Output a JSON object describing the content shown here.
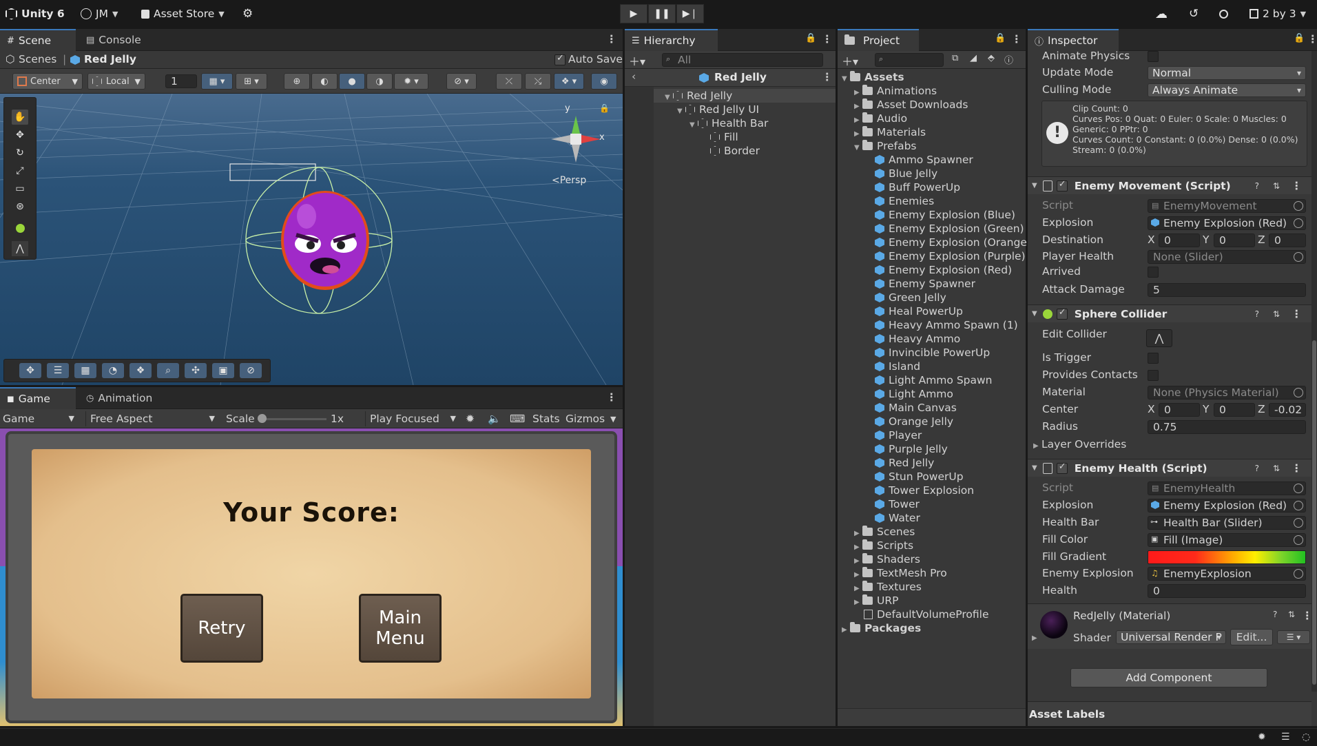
{
  "topbar": {
    "app_title": "Unity 6",
    "account": "JM",
    "asset_store": "Asset Store",
    "layout": "2 by 3"
  },
  "scene_panel": {
    "tabs": [
      "Scene",
      "Console"
    ],
    "breadcrumb": {
      "root": "Scenes",
      "current": "Red Jelly"
    },
    "auto_save": "Auto Save",
    "pivot": "Center",
    "space": "Local",
    "snap_value": "1",
    "persp_label": "<Persp",
    "axis_x": "x",
    "axis_y": "y"
  },
  "game_panel": {
    "tabs": [
      "Game",
      "Animation"
    ],
    "display": "Game",
    "aspect": "Free Aspect",
    "scale_label": "Scale",
    "scale_value": "1x",
    "play_mode": "Play Focused",
    "stats": "Stats",
    "gizmos": "Gizmos",
    "score_title": "Your Score:",
    "retry": "Retry",
    "main_menu_1": "Main",
    "main_menu_2": "Menu"
  },
  "hierarchy": {
    "tab": "Hierarchy",
    "search_placeholder": "All",
    "scene_name": "Red Jelly",
    "items": [
      {
        "label": "Red Jelly",
        "depth": 0
      },
      {
        "label": "Red Jelly UI",
        "depth": 1
      },
      {
        "label": "Health Bar",
        "depth": 2
      },
      {
        "label": "Fill",
        "depth": 3
      },
      {
        "label": "Border",
        "depth": 3
      }
    ]
  },
  "project": {
    "tab": "Project",
    "root": "Assets",
    "folders_top": [
      "Animations",
      "Asset Downloads",
      "Audio",
      "Materials"
    ],
    "prefabs_folder": "Prefabs",
    "prefabs": [
      "Ammo Spawner",
      "Blue Jelly",
      "Buff PowerUp",
      "Enemies",
      "Enemy Explosion (Blue)",
      "Enemy Explosion (Green)",
      "Enemy Explosion (Orange)",
      "Enemy Explosion (Purple)",
      "Enemy Explosion (Red)",
      "Enemy Spawner",
      "Green Jelly",
      "Heal PowerUp",
      "Heavy Ammo Spawn (1)",
      "Heavy Ammo",
      "Invincible PowerUp",
      "Island",
      "Light Ammo Spawn",
      "Light Ammo",
      "Main Canvas",
      "Orange Jelly",
      "Player",
      "Purple Jelly",
      "Red Jelly",
      "Stun PowerUp",
      "Tower Explosion",
      "Tower",
      "Water"
    ],
    "folders_bottom": [
      "Scenes",
      "Scripts",
      "Shaders",
      "TextMesh Pro",
      "Textures",
      "URP"
    ],
    "profile": "DefaultVolumeProfile",
    "packages": "Packages"
  },
  "inspector": {
    "tab": "Inspector",
    "animator": {
      "animate_physics": "Animate Physics",
      "update_mode_label": "Update Mode",
      "update_mode": "Normal",
      "culling_mode_label": "Culling Mode",
      "culling_mode": "Always Animate",
      "info": [
        "Clip Count: 0",
        "Curves Pos: 0 Quat: 0 Euler: 0 Scale: 0 Muscles: 0",
        "Generic: 0 PPtr: 0",
        "Curves Count: 0 Constant: 0 (0.0%) Dense: 0 (0.0%)",
        "Stream: 0 (0.0%)"
      ]
    },
    "enemy_movement": {
      "title": "Enemy Movement (Script)",
      "script_label": "Script",
      "script": "EnemyMovement",
      "explosion_label": "Explosion",
      "explosion": "Enemy Explosion (Red)",
      "destination_label": "Destination",
      "dx": "0",
      "dy": "0",
      "dz": "0",
      "player_health_label": "Player Health",
      "player_health": "None (Slider)",
      "arrived_label": "Arrived",
      "attack_damage_label": "Attack Damage",
      "attack_damage": "5"
    },
    "sphere_collider": {
      "title": "Sphere Collider",
      "edit_collider_label": "Edit Collider",
      "is_trigger_label": "Is Trigger",
      "provides_contacts_label": "Provides Contacts",
      "material_label": "Material",
      "material": "None (Physics Material)",
      "center_label": "Center",
      "cx": "0",
      "cy": "0",
      "cz": "-0.02",
      "radius_label": "Radius",
      "radius": "0.75",
      "layer_overrides": "Layer Overrides"
    },
    "enemy_health": {
      "title": "Enemy Health (Script)",
      "script_label": "Script",
      "script": "EnemyHealth",
      "explosion_label": "Explosion",
      "explosion": "Enemy Explosion (Red)",
      "health_bar_label": "Health Bar",
      "health_bar": "Health Bar (Slider)",
      "fill_color_label": "Fill Color",
      "fill_color": "Fill (Image)",
      "fill_gradient_label": "Fill Gradient",
      "enemy_explosion_label": "Enemy Explosion",
      "enemy_explosion": "EnemyExplosion",
      "health_label": "Health",
      "health": "0"
    },
    "material": {
      "name": "RedJelly (Material)",
      "shader_label": "Shader",
      "shader": "Universal Render P",
      "edit": "Edit..."
    },
    "add_component": "Add Component",
    "asset_labels": "Asset Labels"
  },
  "axis_labels": {
    "x": "X",
    "y": "Y",
    "z": "Z"
  },
  "colors": {
    "accent": "#3a79bb",
    "sky": "#234a6d",
    "jelly": "#a02ac8",
    "parchment": "#e8c493",
    "gradient": [
      "#ff1a1a",
      "#ffb000",
      "#ffee00",
      "#22c022"
    ]
  }
}
